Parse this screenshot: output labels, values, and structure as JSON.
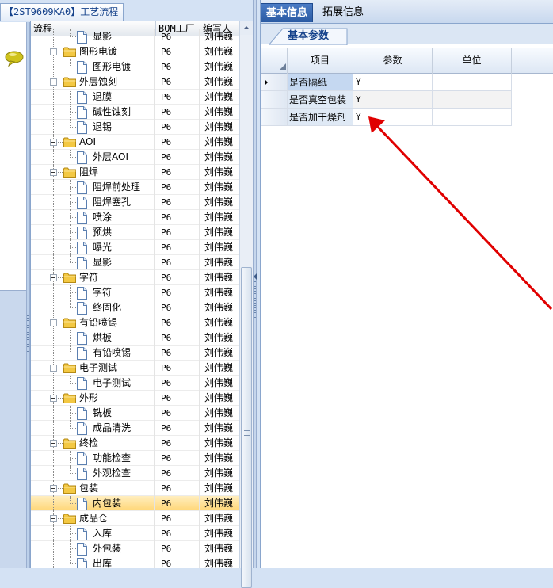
{
  "window": {
    "title_tab": "【2ST9609KA0】工艺流程",
    "title_code": "【2ST9609KA0】",
    "title_text": "工艺流程"
  },
  "tree": {
    "columns": [
      "流程",
      "BOM工厂",
      "编写人"
    ],
    "rows": [
      {
        "label": "显影",
        "type": "leaf",
        "bom": "P6",
        "author": "刘伟巍",
        "partial": true
      },
      {
        "label": "图形电镀",
        "type": "group",
        "bom": "P6",
        "author": "刘伟巍"
      },
      {
        "label": "图形电镀",
        "type": "leaf",
        "bom": "P6",
        "author": "刘伟巍"
      },
      {
        "label": "外层蚀刻",
        "type": "group",
        "bom": "P6",
        "author": "刘伟巍"
      },
      {
        "label": "退膜",
        "type": "leaf",
        "bom": "P6",
        "author": "刘伟巍"
      },
      {
        "label": "碱性蚀刻",
        "type": "leaf",
        "bom": "P6",
        "author": "刘伟巍"
      },
      {
        "label": "退锡",
        "type": "leaf",
        "bom": "P6",
        "author": "刘伟巍"
      },
      {
        "label": "AOI",
        "type": "group",
        "bom": "P6",
        "author": "刘伟巍"
      },
      {
        "label": "外层AOI",
        "type": "leaf",
        "bom": "P6",
        "author": "刘伟巍"
      },
      {
        "label": "阻焊",
        "type": "group",
        "bom": "P6",
        "author": "刘伟巍"
      },
      {
        "label": "阻焊前处理",
        "type": "leaf",
        "bom": "P6",
        "author": "刘伟巍"
      },
      {
        "label": "阻焊塞孔",
        "type": "leaf",
        "bom": "P6",
        "author": "刘伟巍"
      },
      {
        "label": "喷涂",
        "type": "leaf",
        "bom": "P6",
        "author": "刘伟巍"
      },
      {
        "label": "预烘",
        "type": "leaf",
        "bom": "P6",
        "author": "刘伟巍"
      },
      {
        "label": "曝光",
        "type": "leaf",
        "bom": "P6",
        "author": "刘伟巍"
      },
      {
        "label": "显影",
        "type": "leaf",
        "bom": "P6",
        "author": "刘伟巍"
      },
      {
        "label": "字符",
        "type": "group",
        "bom": "P6",
        "author": "刘伟巍"
      },
      {
        "label": "字符",
        "type": "leaf",
        "bom": "P6",
        "author": "刘伟巍"
      },
      {
        "label": "终固化",
        "type": "leaf",
        "bom": "P6",
        "author": "刘伟巍"
      },
      {
        "label": "有铅喷锡",
        "type": "group",
        "bom": "P6",
        "author": "刘伟巍"
      },
      {
        "label": "烘板",
        "type": "leaf",
        "bom": "P6",
        "author": "刘伟巍"
      },
      {
        "label": "有铅喷锡",
        "type": "leaf",
        "bom": "P6",
        "author": "刘伟巍"
      },
      {
        "label": "电子测试",
        "type": "group",
        "bom": "P6",
        "author": "刘伟巍"
      },
      {
        "label": "电子测试",
        "type": "leaf",
        "bom": "P6",
        "author": "刘伟巍"
      },
      {
        "label": "外形",
        "type": "group",
        "bom": "P6",
        "author": "刘伟巍"
      },
      {
        "label": "铣板",
        "type": "leaf",
        "bom": "P6",
        "author": "刘伟巍"
      },
      {
        "label": "成品清洗",
        "type": "leaf",
        "bom": "P6",
        "author": "刘伟巍"
      },
      {
        "label": "终检",
        "type": "group",
        "bom": "P6",
        "author": "刘伟巍"
      },
      {
        "label": "功能检查",
        "type": "leaf",
        "bom": "P6",
        "author": "刘伟巍"
      },
      {
        "label": "外观检查",
        "type": "leaf",
        "bom": "P6",
        "author": "刘伟巍"
      },
      {
        "label": "包装",
        "type": "group",
        "bom": "P6",
        "author": "刘伟巍"
      },
      {
        "label": "内包装",
        "type": "leaf",
        "bom": "P6",
        "author": "刘伟巍",
        "selected": true
      },
      {
        "label": "成品仓",
        "type": "group",
        "bom": "P6",
        "author": "刘伟巍"
      },
      {
        "label": "入库",
        "type": "leaf",
        "bom": "P6",
        "author": "刘伟巍"
      },
      {
        "label": "外包装",
        "type": "leaf",
        "bom": "P6",
        "author": "刘伟巍"
      },
      {
        "label": "出库",
        "type": "leaf",
        "bom": "P6",
        "author": "刘伟巍"
      }
    ]
  },
  "right": {
    "tabs": [
      "基本信息",
      "拓展信息"
    ],
    "active_tab": "基本信息",
    "subtab": "基本参数",
    "param_columns": [
      "项目",
      "参数",
      "单位"
    ],
    "params": [
      {
        "item": "是否隔纸",
        "value": "Y",
        "unit": ""
      },
      {
        "item": "是否真空包装",
        "value": "Y",
        "unit": ""
      },
      {
        "item": "是否加干燥剂",
        "value": "Y",
        "unit": ""
      }
    ]
  },
  "icons": {
    "chat": "chat-bubble-icon",
    "folder": "folder-icon",
    "document": "document-icon",
    "expander": "collapse-minus-icon",
    "scroll_up": "scroll-up-arrow-icon",
    "splitter_left": "splitter-left-arrow-icon",
    "current_row": "current-row-arrow-icon"
  },
  "colors": {
    "active_tab": "#2a5aa3",
    "selected_row": "#ffd778",
    "annotation_arrow": "#e00000",
    "chat_icon": "#c9c100"
  }
}
